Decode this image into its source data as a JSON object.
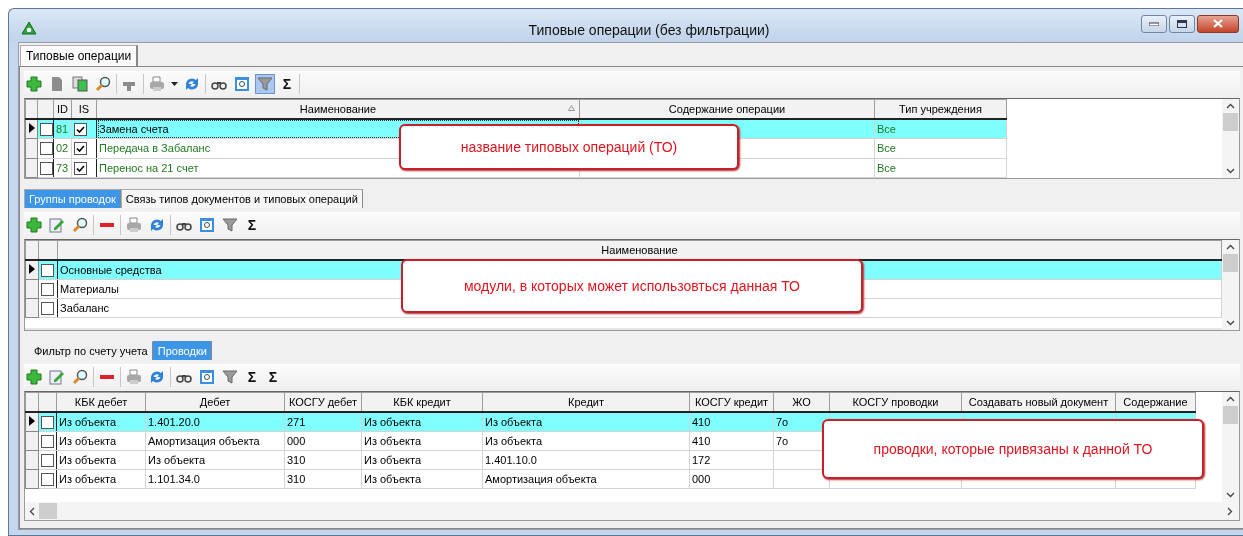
{
  "window": {
    "title": "Типовые операции (без фильтрации)"
  },
  "main_tabs": [
    {
      "label": "Типовые операции",
      "selected": true
    }
  ],
  "operations": {
    "toolbar": {
      "filter_pressed": true,
      "sum_labels": [
        "Σ"
      ]
    },
    "columns": [
      "ID",
      "IS",
      "Наименование",
      "Содержание операции",
      "Тип учреждения"
    ],
    "rows": [
      {
        "marked": false,
        "selected": true,
        "id": "81",
        "is_checked": true,
        "name": "Замена счета",
        "institution_type": "Все"
      },
      {
        "marked": false,
        "selected": false,
        "id": "02",
        "is_checked": true,
        "name": "Передача в Забаланс",
        "institution_type": "Все"
      },
      {
        "marked": false,
        "selected": false,
        "id": "73",
        "is_checked": true,
        "name": "Перенос на 21 счет",
        "institution_type": "Все"
      }
    ],
    "callout": "название типовых операций (ТО)"
  },
  "detail_tabs": [
    {
      "label": "Группы проводок",
      "selected": true
    },
    {
      "label": "Связь типов документов и типовых операций",
      "selected": false
    }
  ],
  "groups": {
    "toolbar": {
      "filter_pressed": false,
      "sum_labels": [
        "Σ"
      ]
    },
    "columns": [
      "Наименование"
    ],
    "rows": [
      {
        "marked": false,
        "selected": true,
        "name": "Основные средства"
      },
      {
        "marked": false,
        "selected": false,
        "name": "Материалы"
      },
      {
        "marked": false,
        "selected": false,
        "name": "Забаланс"
      }
    ],
    "callout": "модули, в которых может использовться данная ТО"
  },
  "entry_tabs": [
    {
      "label": "Фильтр по счету учета",
      "selected": false
    },
    {
      "label": "Проводки",
      "selected": true
    }
  ],
  "entries": {
    "toolbar": {
      "filter_pressed": false,
      "sum_labels": [
        "Σ",
        "Σ"
      ]
    },
    "columns": [
      "КБК дебет",
      "Дебет",
      "КОСГУ дебет",
      "КБК кредит",
      "Кредит",
      "КОСГУ кредит",
      "ЖО",
      "КОСГУ проводки",
      "Создавать новый документ",
      "Содержание"
    ],
    "rows": [
      {
        "marked": false,
        "selected": true,
        "cells": [
          "Из объекта",
          "1.401.20.0",
          "271",
          "Из объекта",
          "Из объекта",
          "410",
          "7о"
        ]
      },
      {
        "marked": false,
        "selected": false,
        "cells": [
          "Из объекта",
          "Амортизация объекта",
          "000",
          "Из объекта",
          "Из объекта",
          "410",
          "7о"
        ]
      },
      {
        "marked": false,
        "selected": false,
        "cells": [
          "Из объекта",
          "Из объекта",
          "310",
          "Из объекта",
          "1.401.10.0",
          "172",
          null
        ]
      },
      {
        "marked": false,
        "selected": false,
        "cells": [
          "Из объекта",
          "1.101.34.0",
          "310",
          "Из объекта",
          "Амортизация объекта",
          "000",
          null
        ]
      }
    ],
    "callout": "проводки, которые привязаны к данной ТО"
  }
}
